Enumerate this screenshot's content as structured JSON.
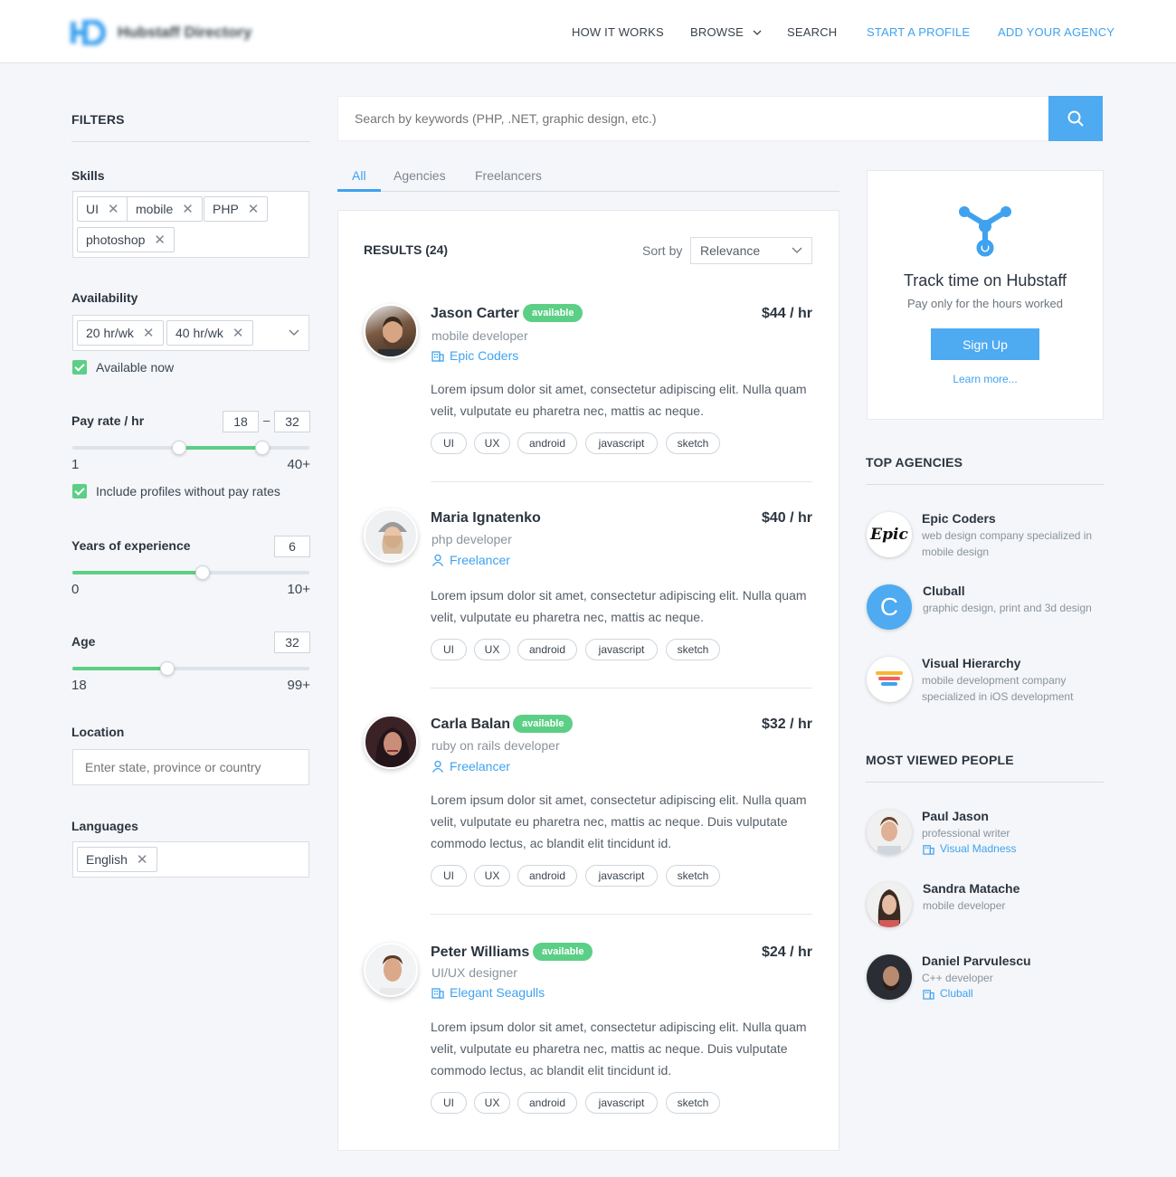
{
  "header": {
    "logo_text": "Hubstaff Directory",
    "nav": {
      "how": "HOW IT WORKS",
      "browse": "BROWSE",
      "search": "SEARCH",
      "start": "START A PROFILE",
      "add": "ADD YOUR AGENCY"
    }
  },
  "filters": {
    "title": "FILTERS",
    "skills": {
      "label": "Skills",
      "chips": [
        "UI",
        "mobile",
        "PHP",
        "photoshop"
      ]
    },
    "availability": {
      "label": "Availability",
      "chips": [
        "20 hr/wk",
        "40 hr/wk"
      ],
      "checkbox": "Available now"
    },
    "pay_rate": {
      "label": "Pay rate / hr",
      "min_value": "18",
      "dash": "–",
      "max_value": "32",
      "range_min": "1",
      "range_max": "40+",
      "checkbox": "Include profiles without pay rates",
      "slider_low": 0.45,
      "slider_high": 0.8
    },
    "experience": {
      "label": "Years of experience",
      "value": "6",
      "range_min": "0",
      "range_max": "10+",
      "slider_value": 0.55
    },
    "age": {
      "label": "Age",
      "value": "32",
      "range_min": "18",
      "range_max": "99+",
      "slider_value": 0.4
    },
    "location": {
      "label": "Location",
      "placeholder": "Enter state, province or country"
    },
    "languages": {
      "label": "Languages",
      "chips": [
        "English"
      ]
    }
  },
  "search": {
    "placeholder": "Search by keywords (PHP, .NET, graphic design, etc.)"
  },
  "tabs": [
    "All",
    "Agencies",
    "Freelancers"
  ],
  "results": {
    "title": "RESULTS (24)",
    "sort_label": "Sort by",
    "sort_value": "Relevance",
    "items": [
      {
        "name": "Jason Carter",
        "badge": "available",
        "role": "mobile developer",
        "company": "Epic Coders",
        "company_icon": "building-icon",
        "rate": "$44 / hr",
        "desc": "Lorem ipsum dolor sit amet, consectetur adipiscing elit. Nulla quam velit, vulputate eu pharetra nec, mattis ac neque."
      },
      {
        "name": "Maria Ignatenko",
        "badge": "",
        "role": "php developer",
        "company": "Freelancer",
        "company_icon": "person-icon",
        "rate": "$40 / hr",
        "desc": "Lorem ipsum dolor sit amet, consectetur adipiscing elit. Nulla quam velit, vulputate eu pharetra nec, mattis ac neque."
      },
      {
        "name": "Carla Balan",
        "badge": "available",
        "role": "ruby on rails developer",
        "company": "Freelancer",
        "company_icon": "person-icon",
        "rate": "$32 / hr",
        "desc": "Lorem ipsum dolor sit amet, consectetur adipiscing elit. Nulla quam velit, vulputate eu pharetra nec, mattis ac neque. Duis vulputate commodo lectus, ac blandit elit tincidunt id."
      },
      {
        "name": "Peter Williams",
        "badge": "available",
        "role": "UI/UX designer",
        "company": "Elegant Seagulls",
        "company_icon": "building-icon",
        "rate": "$24 / hr",
        "desc": "Lorem ipsum dolor sit amet, consectetur adipiscing elit. Nulla quam velit, vulputate eu pharetra nec, mattis ac neque. Duis vulputate commodo lectus, ac blandit elit tincidunt id."
      }
    ],
    "tags": [
      "UI",
      "UX",
      "android",
      "javascript",
      "sketch"
    ]
  },
  "promo": {
    "title": "Track time on Hubstaff",
    "subtitle": "Pay only for the hours worked",
    "button": "Sign Up",
    "link": "Learn more..."
  },
  "top_agencies": {
    "title": "TOP AGENCIES",
    "items": [
      {
        "name": "Epic Coders",
        "desc": "web design company specialized in mobile design",
        "logo_text": "Epic"
      },
      {
        "name": "Cluball",
        "desc": "graphic design, print and 3d design",
        "logo_text": "C"
      },
      {
        "name": "Visual Hierarchy",
        "desc": "mobile development company specialized in iOS development",
        "logo_text": ""
      }
    ]
  },
  "most_viewed": {
    "title": "MOST VIEWED PEOPLE",
    "items": [
      {
        "name": "Paul Jason",
        "role": "professional writer",
        "company": "Visual Madness"
      },
      {
        "name": "Sandra Matache",
        "role": "mobile developer",
        "company": ""
      },
      {
        "name": "Daniel Parvulescu",
        "role": "C++ developer",
        "company": "Cluball"
      }
    ]
  },
  "colors": {
    "accent": "#3fa2ef",
    "green": "#5ccf86",
    "bg": "#f4f6f9"
  }
}
